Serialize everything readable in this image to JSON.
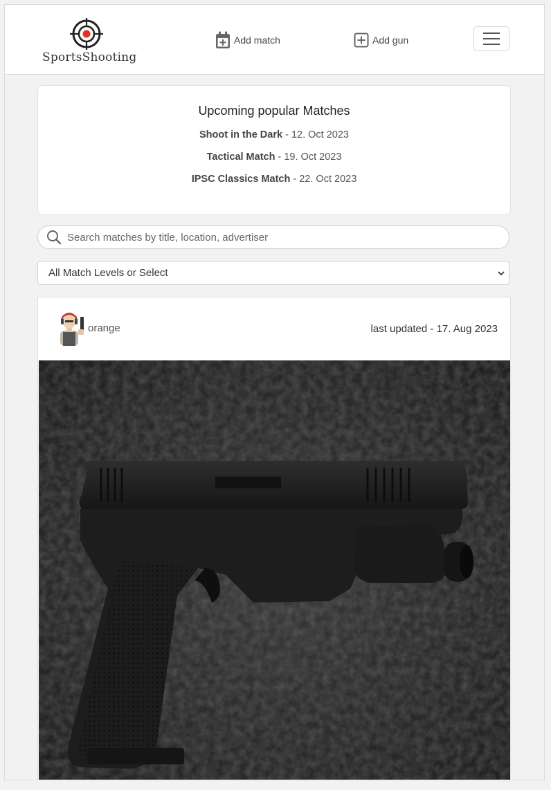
{
  "navbar": {
    "brand": "SportsShooting",
    "add_match_label": "Add match",
    "add_gun_label": "Add gun"
  },
  "upcoming": {
    "title": "Upcoming popular Matches",
    "matches": [
      {
        "name": "Shoot in the Dark",
        "date": " - 12. Oct 2023"
      },
      {
        "name": "Tactical Match",
        "date": " - 19. Oct 2023"
      },
      {
        "name": "IPSC Classics Match",
        "date": " - 22. Oct 2023"
      }
    ]
  },
  "search": {
    "placeholder": "Search matches by title, location, advertiser"
  },
  "level_filter": {
    "selected": "All Match Levels or Select"
  },
  "post": {
    "username": "orange",
    "updated": "last updated - 17. Aug 2023"
  }
}
